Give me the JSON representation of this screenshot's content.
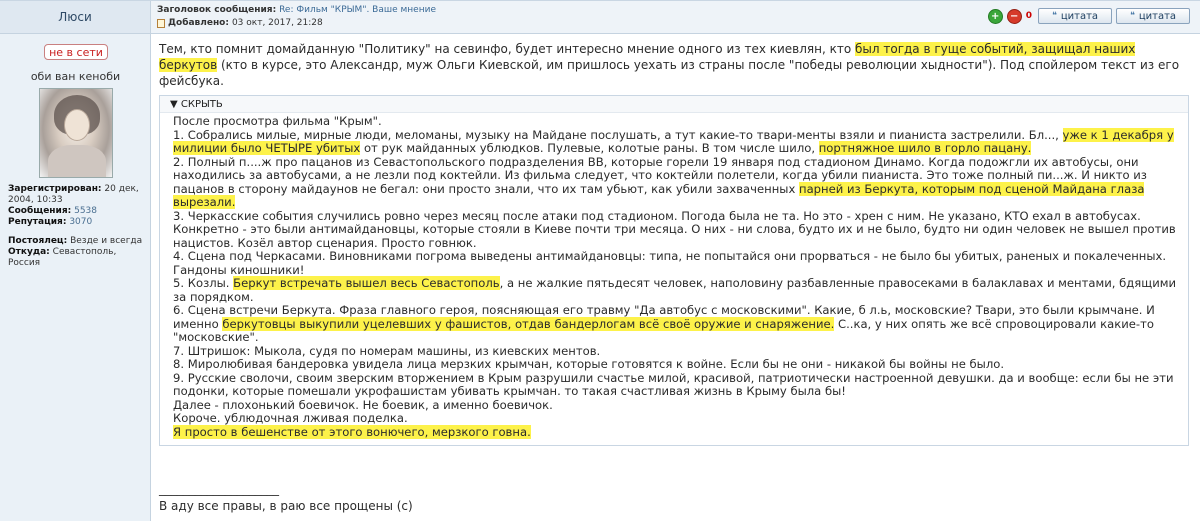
{
  "author": {
    "name": "Люси",
    "status": "не в сети",
    "title": "оби ван кеноби",
    "stats": {
      "registered_label": "Зарегистрирован:",
      "registered_value": "20 дек, 2004, 10:33",
      "messages_label": "Сообщения:",
      "messages_value": "5538",
      "reputation_label": "Репутация:",
      "reputation_value": "3070",
      "postoyalets_label": "Постоялец:",
      "postoyalets_value": "Везде и всегда",
      "from_label": "Откуда:",
      "from_value": "Севастополь, Россия"
    }
  },
  "header": {
    "subject_label": "Заголовок сообщения:",
    "subject_value": "Re: Фильм \"КРЫМ\". Ваше мнение",
    "added_label": "Добавлено:",
    "added_value": "03 окт, 2017, 21:28",
    "vote_up_icon": "thumb-up-icon",
    "vote_down_icon": "thumb-down-icon",
    "score": "0",
    "quote_label": "цитата",
    "quote2_label": "цитата"
  },
  "post": {
    "intro": {
      "a": "Тем, кто помнит домайданную \"Политику\" на севинфо, будет интересно мнение одного из тех киевлян, кто ",
      "b": "был тогда в гуще событий, защищал наших беркутов",
      "c": " (кто в курсе, это Александр, муж Ольги Киевской, им пришлось уехать из страны после \"победы революции хыдности\"). Под спойлером текст из его фейсбука."
    },
    "spoiler_label": "▼ СКРЫТЬ",
    "lines": {
      "l0": "После просмотра фильма \"Крым\".",
      "l1a": "1. Собрались милые, мирные люди, меломаны, музыку на Майдане послушать, а тут какие-то твари-менты взяли и пианиста застрелили. Бл..., ",
      "l1b": "уже к 1 декабря у милиции было ЧЕТЫРЕ убитых",
      "l1c": " от рук майданных ублюдков. Пулевые, колотые раны. В том числе шило, ",
      "l1d": "портняжное шило в горло пацану.",
      "l2a": "2. Полный п....ж про пацанов из Севастопольского подразделения ВВ, которые горели 19 января под стадионом Динамо. Когда подожгли их автобусы, они находились за автобусами, а не лезли под коктейли. Из фильма следует, что коктейли полетели, когда убили пианиста. Это тоже полный пи...ж. И никто из пацанов в сторону майдаунов не бегал: они просто знали, что их там убьют, как убили захваченных ",
      "l2b": "парней из Беркута, которым под сценой Майдана глаза вырезали.",
      "l3": "3. Черкасские события случились ровно через месяц после атаки под стадионом. Погода была не та. Но это - хрен с ним. Не указано, КТО ехал в автобусах. Конкретно - это были антимайдановцы, которые стояли в Киеве почти три месяца. О них - ни слова, будто их и не было, будто ни один человек не вышел против нацистов. Козёл автор сценария. Просто говнюк.",
      "l4": "4. Сцена под Черкасами. Виновниками погрома выведены антимайдановцы: типа, не попытайся они прорваться - не было бы убитых, раненых и покалеченных. Гандоны киношники!",
      "l5a": "5. Козлы. ",
      "l5b": "Беркут встречать вышел весь Севастополь",
      "l5c": ", а не жалкие пятьдесят человек, наполовину разбавленные правосеками в балаклавах и ментами, бдящими за порядком.",
      "l6a": "6. Сцена встречи Беркута. Фраза главного героя, поясняющая его травму \"Да автобус с московскими\". Какие, б л.ь, московские? Твари, это были крымчане. И именно ",
      "l6b": "беркутовцы выкупили уцелевших у фашистов, отдав бандерлогам всё своё оружие и снаряжение.",
      "l6c": " С..ка, у них опять же всё спровоцировали какие-то \"московские\".",
      "l7": "7. Штришок: Мыкола, судя по номерам машины, из киевских ментов.",
      "l8": "8. Миролюбивая бандеровка увидела лица мерзких крымчан, которые готовятся к войне. Если бы не они - никакой бы войны не было.",
      "l9": "9. Русские сволочи, своим зверским вторжением в Крым разрушили счастье милой, красивой, патриотически настроенной девушки. да и вообще: если бы не эти подонки, которые помешали укрофашистам убивать крымчан. то такая счастливая жизнь в Крыму была бы!",
      "l10": "Далее - плохонький боевичок. Не боевик, а именно боевичок.",
      "l11": "Короче. ублюдочная лживая поделка.",
      "l12": "Я просто в бешенстве от этого вонючего, мерзкого говна."
    },
    "signature_line": "____________________",
    "signature": "В аду все правы, в раю все прощены (с)"
  },
  "colors": {
    "highlight": "#fdf24a",
    "offline": "#c81e1e",
    "link": "#3b6a96"
  }
}
